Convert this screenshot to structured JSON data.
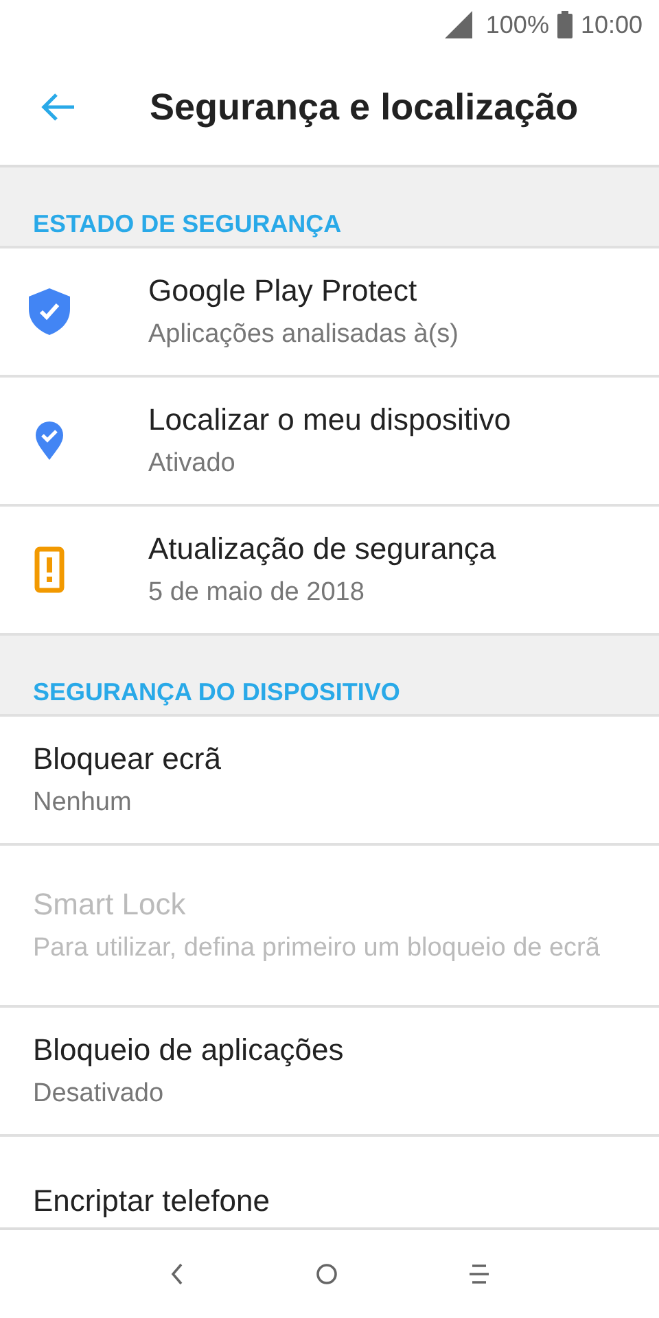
{
  "status_bar": {
    "battery": "100%",
    "time": "10:00"
  },
  "app_bar": {
    "title": "Segurança e localização"
  },
  "sections": [
    {
      "header": "ESTADO DE SEGURANÇA",
      "items": [
        {
          "kind": "status",
          "title": "Google Play Protect",
          "subtitle": "Aplicações analisadas à(s)",
          "disabled": false
        },
        {
          "kind": "status",
          "title": "Localizar o meu dispositivo",
          "subtitle": "Ativado",
          "disabled": false
        },
        {
          "kind": "status",
          "title": "Atualização de segurança",
          "subtitle": "5 de maio de 2018",
          "disabled": false
        }
      ]
    },
    {
      "header": "SEGURANÇA DO DISPOSITIVO",
      "items": [
        {
          "kind": "plain",
          "title": "Bloquear ecrã",
          "subtitle": "Nenhum",
          "disabled": false
        },
        {
          "kind": "plain",
          "title": "Smart Lock",
          "subtitle": "Para utilizar, defina primeiro um bloqueio de ecrã",
          "disabled": true
        },
        {
          "kind": "plain",
          "title": "Bloqueio de aplicações",
          "subtitle": "Desativado",
          "disabled": false
        },
        {
          "kind": "plain",
          "title": "Encriptar telefone",
          "disabled": false
        }
      ]
    }
  ]
}
